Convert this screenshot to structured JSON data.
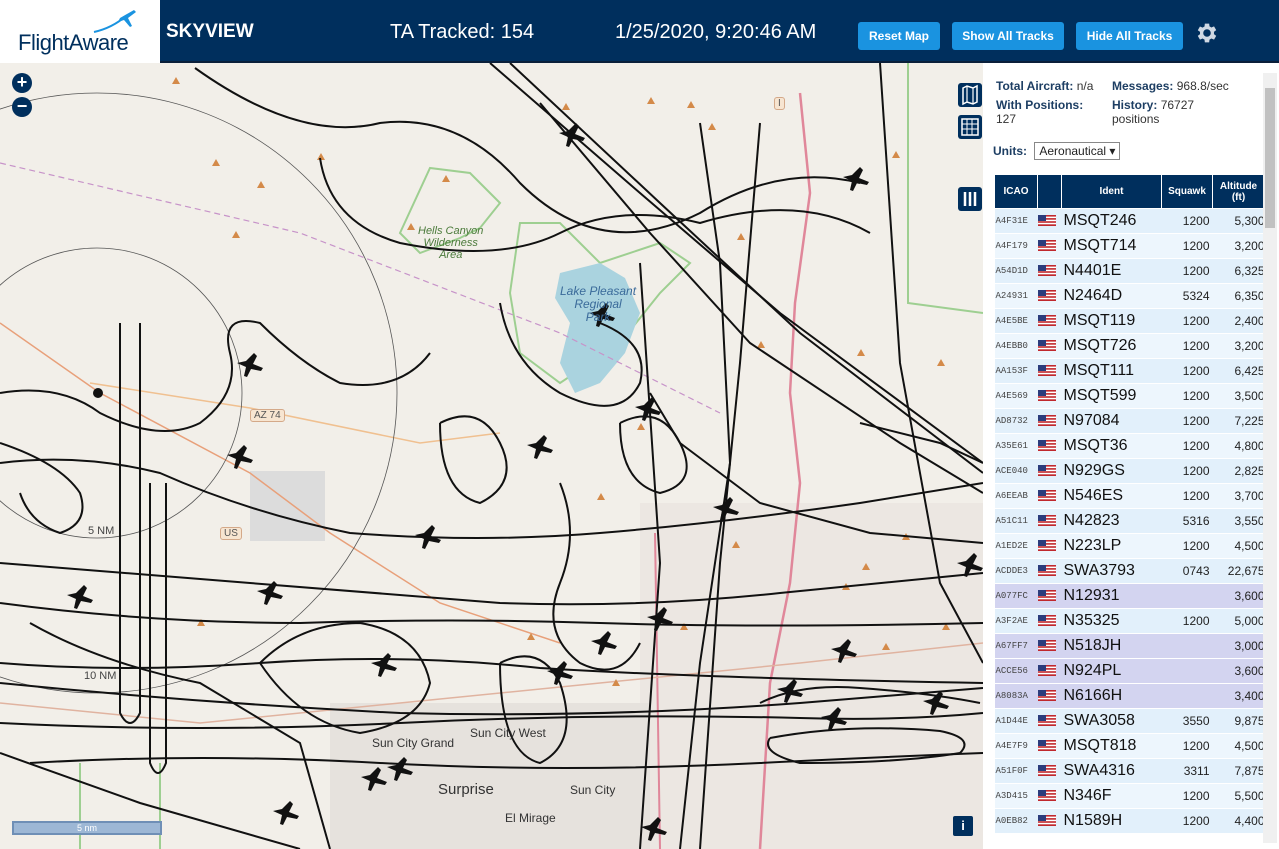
{
  "header": {
    "logo_text": "FlightAware",
    "app_name": "SKYVIEW",
    "ta_tracked": "TA Tracked: 154",
    "datetime": "1/25/2020, 9:20:46 AM",
    "buttons": {
      "reset": "Reset Map",
      "show_all": "Show All Tracks",
      "hide_all": "Hide All Tracks"
    }
  },
  "map": {
    "zoom_in": "+",
    "zoom_out": "−",
    "scale_label": "5 nm",
    "info_label": "i",
    "labels": {
      "hells_canyon": "Hells Canyon\nWilderness\nArea",
      "lake_pleasant": "Lake Pleasant\nRegional\nPark",
      "az74": "AZ 74",
      "us60": "US",
      "sun_city_grand": "Sun City Grand",
      "sun_city_west": "Sun City West",
      "surprise": "Surprise",
      "sun_city": "Sun City",
      "el_mirage": "El Mirage",
      "range5": "5 NM",
      "range10": "10 NM",
      "i17": "I"
    }
  },
  "panel": {
    "total_aircraft_label": "Total Aircraft:",
    "total_aircraft_value": "n/a",
    "messages_label": "Messages:",
    "messages_value": "968.8/sec",
    "with_positions_label": "With Positions:",
    "with_positions_value": "127",
    "history_label": "History:",
    "history_value": "76727 positions",
    "units_label": "Units:",
    "units_value": "Aeronautical",
    "columns": [
      "ICAO",
      "",
      "Ident",
      "Squawk",
      "Altitude (ft)"
    ],
    "rows": [
      {
        "icao": "A4F31E",
        "ident": "MSQT246",
        "squawk": "1200",
        "alt": "5,300",
        "hl": false
      },
      {
        "icao": "A4F179",
        "ident": "MSQT714",
        "squawk": "1200",
        "alt": "3,200",
        "hl": false
      },
      {
        "icao": "A54D1D",
        "ident": "N4401E",
        "squawk": "1200",
        "alt": "6,325",
        "hl": false
      },
      {
        "icao": "A24931",
        "ident": "N2464D",
        "squawk": "5324",
        "alt": "6,350",
        "hl": false
      },
      {
        "icao": "A4E5BE",
        "ident": "MSQT119",
        "squawk": "1200",
        "alt": "2,400",
        "hl": false
      },
      {
        "icao": "A4EBB0",
        "ident": "MSQT726",
        "squawk": "1200",
        "alt": "3,200",
        "hl": false
      },
      {
        "icao": "AA153F",
        "ident": "MSQT111",
        "squawk": "1200",
        "alt": "6,425",
        "hl": false
      },
      {
        "icao": "A4E569",
        "ident": "MSQT599",
        "squawk": "1200",
        "alt": "3,500",
        "hl": false
      },
      {
        "icao": "AD8732",
        "ident": "N97084",
        "squawk": "1200",
        "alt": "7,225",
        "hl": false
      },
      {
        "icao": "A35E61",
        "ident": "MSQT36",
        "squawk": "1200",
        "alt": "4,800",
        "hl": false
      },
      {
        "icao": "ACE040",
        "ident": "N929GS",
        "squawk": "1200",
        "alt": "2,825",
        "hl": false
      },
      {
        "icao": "A6EEAB",
        "ident": "N546ES",
        "squawk": "1200",
        "alt": "3,700",
        "hl": false
      },
      {
        "icao": "A51C11",
        "ident": "N42823",
        "squawk": "5316",
        "alt": "3,550",
        "hl": false
      },
      {
        "icao": "A1ED2E",
        "ident": "N223LP",
        "squawk": "1200",
        "alt": "4,500",
        "hl": false
      },
      {
        "icao": "ACDDE3",
        "ident": "SWA3793",
        "squawk": "0743",
        "alt": "22,675",
        "hl": false
      },
      {
        "icao": "A077FC",
        "ident": "N12931",
        "squawk": "",
        "alt": "3,600",
        "hl": true
      },
      {
        "icao": "A3F2AE",
        "ident": "N35325",
        "squawk": "1200",
        "alt": "5,000",
        "hl": false
      },
      {
        "icao": "A67FF7",
        "ident": "N518JH",
        "squawk": "",
        "alt": "3,000",
        "hl": true
      },
      {
        "icao": "ACCE56",
        "ident": "N924PL",
        "squawk": "",
        "alt": "3,600",
        "hl": true
      },
      {
        "icao": "A8083A",
        "ident": "N6166H",
        "squawk": "",
        "alt": "3,400",
        "hl": true
      },
      {
        "icao": "A1D44E",
        "ident": "SWA3058",
        "squawk": "3550",
        "alt": "9,875",
        "hl": false
      },
      {
        "icao": "A4E7F9",
        "ident": "MSQT818",
        "squawk": "1200",
        "alt": "4,500",
        "hl": false
      },
      {
        "icao": "A51F0F",
        "ident": "SWA4316",
        "squawk": "3311",
        "alt": "7,875",
        "hl": false
      },
      {
        "icao": "A3D415",
        "ident": "N346F",
        "squawk": "1200",
        "alt": "5,500",
        "hl": false
      },
      {
        "icao": "A0EB82",
        "ident": "N1589H",
        "squawk": "1200",
        "alt": "4,400",
        "hl": false
      }
    ]
  },
  "colors": {
    "header_bg": "#002f5d",
    "button": "#1a93e0",
    "track": "#111111"
  }
}
